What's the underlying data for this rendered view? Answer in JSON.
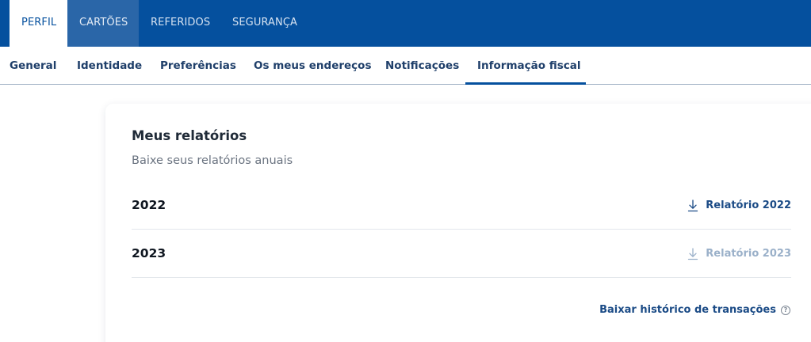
{
  "top_tabs": [
    "PERFIL",
    "CARTÕES",
    "REFERIDOS",
    "SEGURANÇA"
  ],
  "sub_tabs": [
    "General",
    "Identidade",
    "Preferências",
    "Os meus endereços",
    "Notificações",
    "Informação fiscal"
  ],
  "reports": {
    "title": "Meus relatórios",
    "subtitle": "Baixe seus relatórios anuais",
    "rows": [
      {
        "year": "2022",
        "link": "Relatório 2022",
        "enabled": true
      },
      {
        "year": "2023",
        "link": "Relatório 2023",
        "enabled": false
      }
    ],
    "history_link": "Baixar histórico de transações"
  },
  "colors": {
    "brand": "#05509e",
    "link": "#1b4b86",
    "link_disabled": "#9ab0c9"
  },
  "icons": {
    "download": "download-icon",
    "help": "help-circle-icon"
  }
}
